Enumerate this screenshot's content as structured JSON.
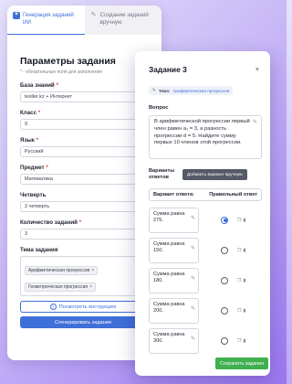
{
  "tabs": [
    {
      "label": "Генерация заданий ИИ",
      "active": true
    },
    {
      "label": "Создание заданий вручную",
      "active": false
    }
  ],
  "form": {
    "title": "Параметры задания",
    "subtitle": "* - обязательные поля для заполнения",
    "fields": {
      "kb_label": "База знаний",
      "kb_value": "testler.kz + Интернет",
      "class_label": "Класс",
      "class_value": "9",
      "lang_label": "Язык",
      "lang_value": "Русский",
      "subject_label": "Предмет",
      "subject_value": "Математика",
      "quarter_label": "Четверть",
      "quarter_value": "2 четверть",
      "count_label": "Количество заданий",
      "count_value": "3",
      "topic_label": "Тема задания",
      "topics": [
        "Арифметическая прогрессия",
        "Геометрическая прогрессия"
      ]
    },
    "required_mark": "*",
    "instruction_button": "Посмотреть инструкцию",
    "generate_button": "Сгенерировать задания"
  },
  "modal": {
    "title": "Задание 3",
    "close": "×",
    "topic_prefix": "Тема:",
    "topic_value": "Арифметическая прогрессия",
    "question_label": "Вопрос",
    "question_text": "В арифметической прогрессии первый член равен a₁ = 3, а разность прогрессии d = 5. Найдите сумму первых 10 членов этой прогрессии.",
    "variants_label": "Варианты ответов",
    "add_variant_button": "Добавить вариант вручную",
    "variant_header": "Вариант ответа:",
    "correct_header": "Правильный ответ",
    "answers": [
      {
        "text": "Сумма равна 275.",
        "correct": true
      },
      {
        "text": "Сумма равна 150.",
        "correct": false
      },
      {
        "text": "Сумма равна 180.",
        "correct": false
      },
      {
        "text": "Сумма равна 200.",
        "correct": false
      },
      {
        "text": "Сумма равна 300.",
        "correct": false
      }
    ],
    "save_button": "Сохранить задания"
  },
  "colors": {
    "accent": "#3f6fd8",
    "save": "#3fb04f",
    "required": "#e0443a"
  },
  "icons": [
    "sparkle-icon",
    "pencil-icon",
    "close-icon",
    "info-icon",
    "tag-icon",
    "copy-icon",
    "trash-icon"
  ]
}
